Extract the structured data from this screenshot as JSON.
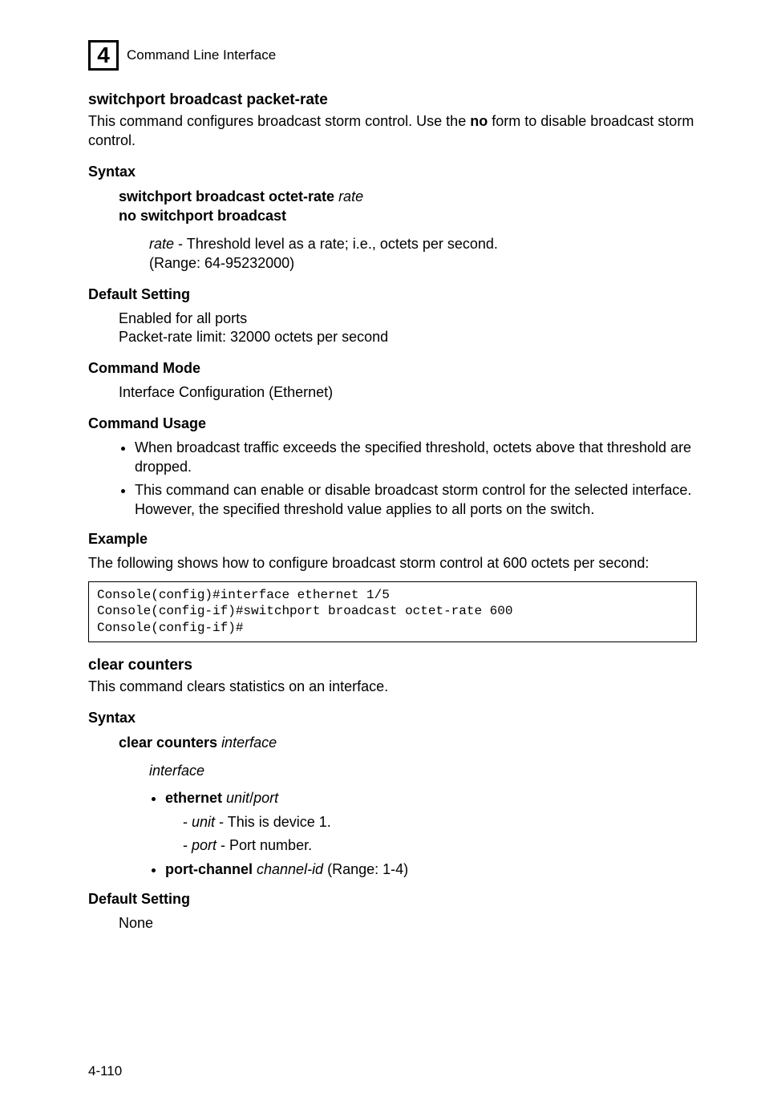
{
  "header": {
    "icon": "4",
    "title": "Command Line Interface"
  },
  "section1": {
    "title": "switchport broadcast packet-rate",
    "intro_pre": "This command configures broadcast storm control. Use the ",
    "intro_bold": "no",
    "intro_post": " form to disable broadcast storm control.",
    "syntax_label": "Syntax",
    "syntax_line1_bold": "switchport broadcast octet-rate ",
    "syntax_line1_ital": "rate",
    "syntax_line2_bold": "no switchport broadcast",
    "rate_label": "rate",
    "rate_desc": " - Threshold level as a rate; i.e., octets per second.",
    "rate_range": "(Range: 64-95232000)",
    "default_label": "Default Setting",
    "default_l1": "Enabled for all ports",
    "default_l2": "Packet-rate limit: 32000 octets per second",
    "mode_label": "Command Mode",
    "mode_text": "Interface Configuration (Ethernet)",
    "usage_label": "Command Usage",
    "usage_b1": "When broadcast traffic exceeds the specified threshold, octets above that threshold are dropped.",
    "usage_b2": "This command can enable or disable broadcast storm control for the selected interface. However, the specified threshold value applies to all ports on the switch.",
    "example_label": "Example",
    "example_text": "The following shows how to configure broadcast storm control at 600 octets per second:",
    "code": "Console(config)#interface ethernet 1/5\nConsole(config-if)#switchport broadcast octet-rate 600\nConsole(config-if)#"
  },
  "section2": {
    "title": "clear counters",
    "intro": "This command clears statistics on an interface.",
    "syntax_label": "Syntax",
    "syntax_bold": "clear counters ",
    "syntax_ital": "interface",
    "iface_label": "interface",
    "eth_bold": "ethernet ",
    "eth_unit": "unit",
    "eth_slash": "/",
    "eth_port": "port",
    "unit_label": "unit",
    "unit_desc": " - This is device 1.",
    "port_label": "port",
    "port_desc": " - Port number.",
    "pc_bold": "port-channel ",
    "pc_ital": "channel-id",
    "pc_range": " (Range: 1-4)",
    "default_label": "Default Setting",
    "default_text": "None"
  },
  "footer": "4-110"
}
